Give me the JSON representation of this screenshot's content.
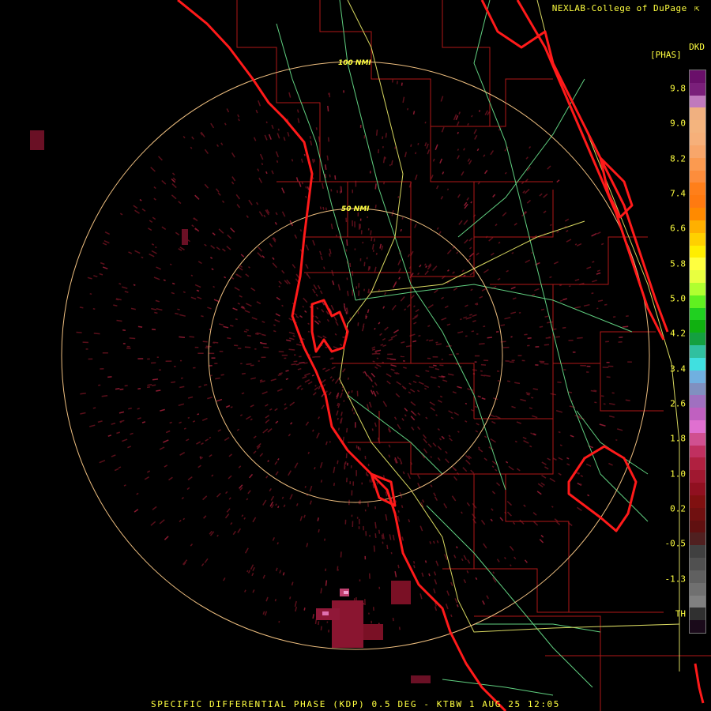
{
  "header": {
    "credit": "NEXLAB-College of DuPage",
    "credit_icon": "cursor-arrow-icon",
    "product_code": "DKD",
    "units": "[PHAS]"
  },
  "range_rings": [
    {
      "label": "100 NMI"
    },
    {
      "label": "50 NMI"
    }
  ],
  "legend": {
    "ticks": [
      "9.8",
      "9.0",
      "8.2",
      "7.4",
      "6.6",
      "5.8",
      "5.0",
      "4.2",
      "3.4",
      "2.6",
      "1.8",
      "1.0",
      "0.2",
      "-0.5",
      "-1.3",
      "TH"
    ],
    "colors": [
      "#6a0f6a",
      "#7a1f7a",
      "#c07abd",
      "#f0b080",
      "#f4b47e",
      "#f6b07a",
      "#f8a66a",
      "#fb9a50",
      "#fd8d3c",
      "#ff7f1a",
      "#ff7a10",
      "#ff8a00",
      "#ffb000",
      "#ffd000",
      "#ffee00",
      "#ffff40",
      "#e8ff40",
      "#b0ff30",
      "#60f020",
      "#20d020",
      "#10b010",
      "#14a040",
      "#30c0a0",
      "#40e0e0",
      "#70b0e0",
      "#8090c0",
      "#a070c0",
      "#c060c0",
      "#e070d0",
      "#d05090",
      "#c03060",
      "#b02040",
      "#a01830",
      "#901020",
      "#801010",
      "#701010",
      "#601010",
      "#502020",
      "#404040",
      "#505050",
      "#606060",
      "#707070",
      "#808080",
      "#303030",
      "#1a0a1a"
    ]
  },
  "footer": {
    "caption": "SPECIFIC DIFFERENTIAL PHASE (KDP) 0.5 DEG - KTBW 1 AUG 25 12:05"
  }
}
